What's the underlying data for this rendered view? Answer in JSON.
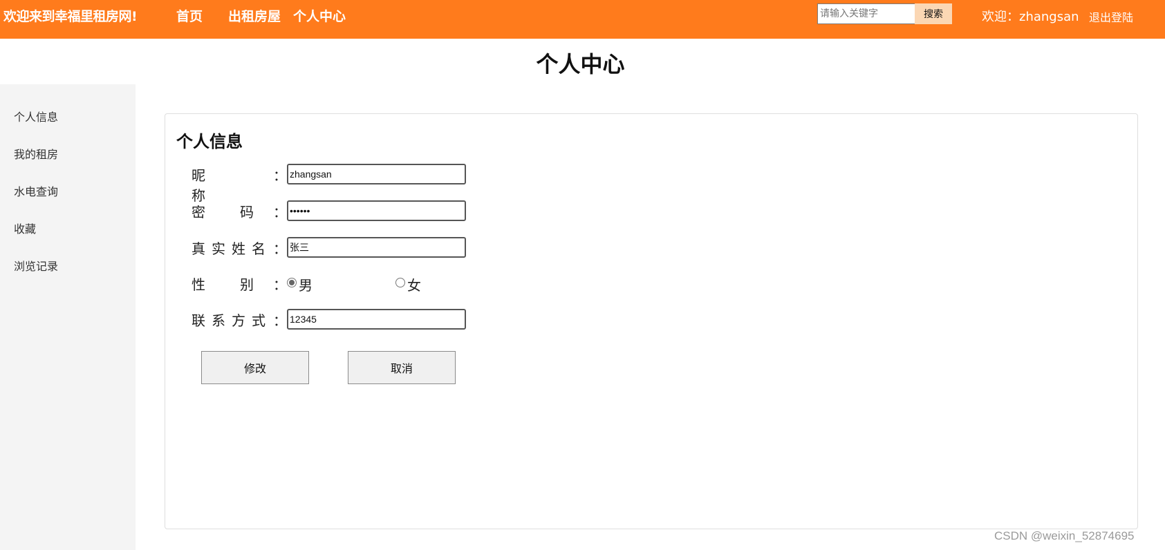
{
  "header": {
    "site_welcome": "欢迎来到幸福里租房网!",
    "nav": {
      "home": "首页",
      "rent_out": "出租房屋",
      "personal_center": "个人中心"
    },
    "search": {
      "placeholder": "请输入关键字",
      "button_label": "搜索"
    },
    "user_welcome": "欢迎：zhangsan",
    "logout": "退出登陆",
    "accent_color": "#ff7b1c"
  },
  "page_title": "个人中心",
  "sidebar": {
    "items": [
      {
        "label": "个人信息"
      },
      {
        "label": "我的租房"
      },
      {
        "label": "水电查询"
      },
      {
        "label": "收藏"
      },
      {
        "label": "浏览记录"
      }
    ]
  },
  "form": {
    "title": "个人信息",
    "colon": "：",
    "nickname": {
      "label": "昵称",
      "value": "zhangsan"
    },
    "password": {
      "label": "密码",
      "value": "123456"
    },
    "real_name": {
      "label": "真实姓名",
      "value": "张三"
    },
    "gender": {
      "label": "性别",
      "options": [
        {
          "label": "男",
          "checked": true
        },
        {
          "label": "女",
          "checked": false
        }
      ]
    },
    "contact": {
      "label": "联系方式",
      "value": "12345"
    },
    "modify_button": "修改",
    "cancel_button": "取消"
  },
  "watermark": "CSDN @weixin_52874695"
}
